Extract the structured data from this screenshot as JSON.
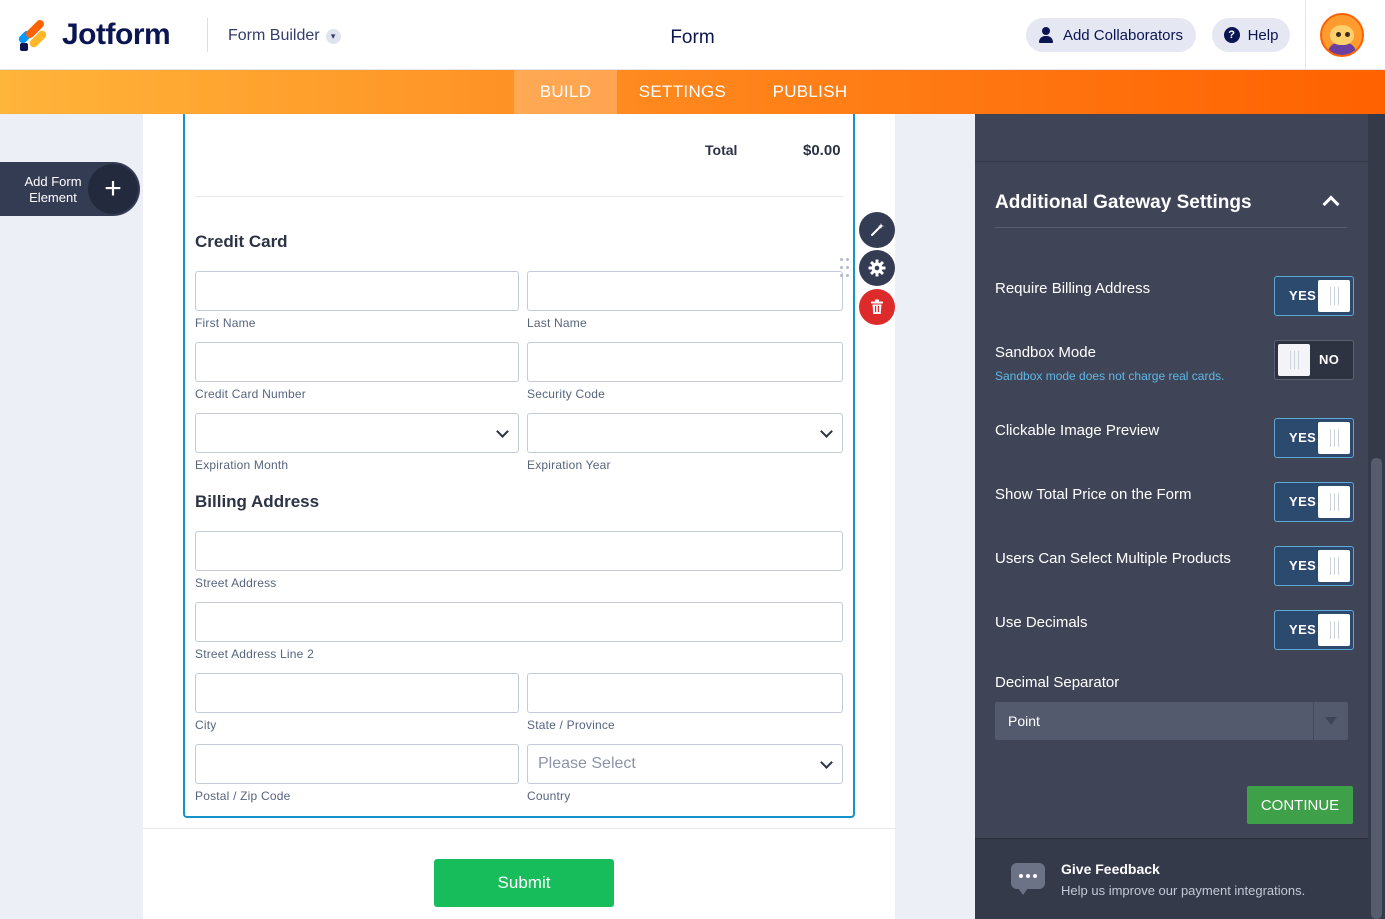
{
  "header": {
    "logo_text": "Jotform",
    "builder_label": "Form Builder",
    "form_title": "Form",
    "collaborators_label": "Add Collaborators",
    "help_label": "Help"
  },
  "nav": {
    "tabs": [
      {
        "label": "BUILD",
        "active": true
      },
      {
        "label": "SETTINGS",
        "active": false
      },
      {
        "label": "PUBLISH",
        "active": false
      }
    ]
  },
  "left": {
    "add_element_label": "Add Form Element",
    "add_symbol": "+"
  },
  "form": {
    "total_label": "Total",
    "total_value": "$0.00",
    "credit_card_title": "Credit Card",
    "first_name": "First Name",
    "last_name": "Last Name",
    "card_number": "Credit Card Number",
    "security_code": "Security Code",
    "exp_month": "Expiration Month",
    "exp_year": "Expiration Year",
    "billing_title": "Billing Address",
    "street": "Street Address",
    "street2": "Street Address Line 2",
    "city": "City",
    "state": "State / Province",
    "zip": "Postal / Zip Code",
    "country": "Country",
    "country_placeholder": "Please Select",
    "submit_label": "Submit"
  },
  "panel": {
    "heading": "Additional Gateway Settings",
    "options": [
      {
        "label": "Require Billing Address",
        "value": "YES"
      },
      {
        "label": "Sandbox Mode",
        "sublabel": "Sandbox mode does not charge real cards.",
        "value": "NO"
      },
      {
        "label": "Clickable Image Preview",
        "value": "YES"
      },
      {
        "label": "Show Total Price on the Form",
        "value": "YES"
      },
      {
        "label": "Users Can Select Multiple Products",
        "value": "YES"
      },
      {
        "label": "Use Decimals",
        "value": "YES"
      }
    ],
    "decimal_label": "Decimal Separator",
    "decimal_value": "Point",
    "continue_label": "CONTINUE",
    "feedback_title": "Give Feedback",
    "feedback_sub": "Help us improve our payment integrations."
  },
  "colors": {
    "brand_orange": "#ff6100",
    "brand_navy": "#0a1551",
    "submit_green": "#18bd5b",
    "continue_green": "#3fa04a",
    "delete_red": "#dd2a2a",
    "field_focus_blue": "#1592c9"
  }
}
